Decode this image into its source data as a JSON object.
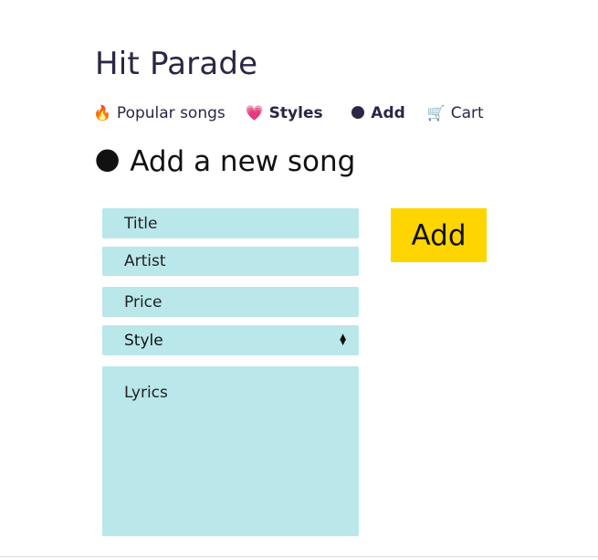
{
  "app": {
    "title": "Hit Parade"
  },
  "nav": {
    "items": [
      {
        "icon": "🔥",
        "label": "Popular songs"
      },
      {
        "icon": "💗",
        "label": "Styles"
      },
      {
        "icon": "🌑",
        "label": "Add"
      },
      {
        "icon": "🛒",
        "label": "Cart"
      }
    ]
  },
  "form": {
    "heading_icon": "🌑",
    "heading": "Add a new song",
    "title_placeholder": "Title",
    "artist_placeholder": "Artist",
    "price_placeholder": "Price",
    "style_selected": "Style",
    "lyrics_placeholder": "Lyrics",
    "submit_label": "Add"
  },
  "colors": {
    "field_background": "#bae7e9",
    "button_background": "#ffd500",
    "title_text": "#2a2745"
  }
}
